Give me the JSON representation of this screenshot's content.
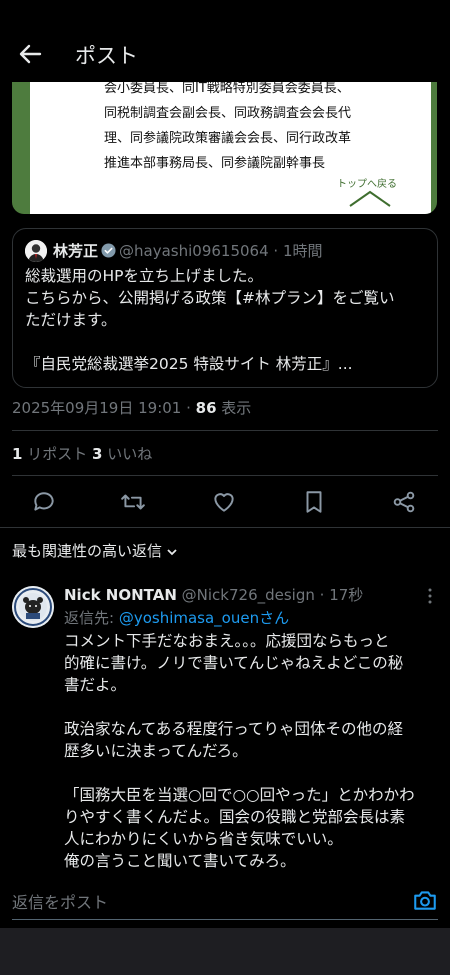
{
  "header": {
    "title": "ポスト"
  },
  "image_card": {
    "lines": [
      "会小委員長、同IT戦略特別委員会委員長、",
      "同税制調査会副会長、同政務調査会会長代",
      "理、同参議院政策審議会会長、同行政改革",
      "推進本部事務局長、同参議院副幹事長"
    ],
    "top_link": "トップへ戻る"
  },
  "quote": {
    "name": "林芳正",
    "handle": "@hayashi09615064",
    "time": "· 1時間",
    "body": [
      "総裁選用のHPを立ち上げました。",
      "こちらから、公開掲げる政策【#林プラン】をご覧い",
      "ただけます。",
      "",
      "『自民党総裁選挙2025 特設サイト 林芳正』..."
    ]
  },
  "post_meta": {
    "timestamp": "2025年09月19日 19:01 · ",
    "views": "86",
    "views_label": " 表示"
  },
  "stats": {
    "reposts": "1",
    "reposts_label": " リポスト",
    "likes": "3",
    "likes_label": " いいね"
  },
  "actions": [
    "reply",
    "repost",
    "like",
    "bookmark",
    "share"
  ],
  "sort": {
    "label": "最も関連性の高い返信"
  },
  "reply": {
    "name": "Nick NONTAN",
    "handle": "@Nick726_design",
    "time": "· 17秒",
    "replying_to_label": "返信先: ",
    "replying_to_handle": "@yoshimasa_ouenさん",
    "body": [
      "コメント下手だなおまえ。。。応援団ならもっと",
      "的確に書け。ノリで書いてんじゃねえよどこの秘",
      "書だよ。",
      "",
      "政治家なんてある程度行ってりゃ団体その他の経",
      "歴多いに決まってんだろ。",
      "",
      "「国務大臣を当選○回で○○回やった」とかわかわ",
      "りやすく書くんだよ。国会の役職と党部会長は素",
      "人にわかりにくいから省き気味でいい。",
      "俺の言うこと聞いて書いてみろ。"
    ]
  },
  "composer": {
    "placeholder": "返信をポスト"
  },
  "colors": {
    "accent": "#1d9bf0",
    "image_green": "#4e7c3e",
    "muted": "#71767b"
  }
}
